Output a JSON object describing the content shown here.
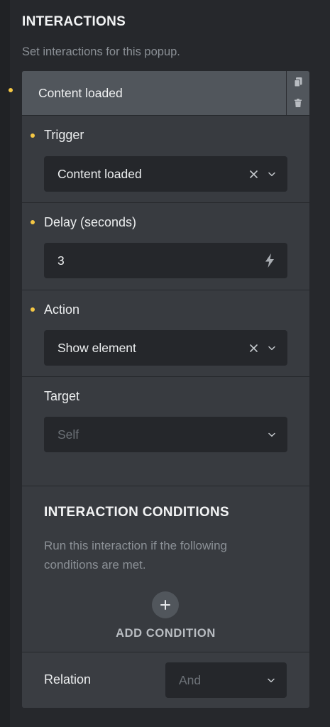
{
  "section": {
    "title": "INTERACTIONS",
    "description": "Set interactions for this popup."
  },
  "interaction": {
    "header_title": "Content loaded",
    "duplicate_icon": "copy-icon",
    "delete_icon": "trash-icon"
  },
  "fields": {
    "trigger": {
      "label": "Trigger",
      "value": "Content loaded"
    },
    "delay": {
      "label": "Delay (seconds)",
      "value": "3",
      "dynamic_icon": "bolt-icon"
    },
    "action": {
      "label": "Action",
      "value": "Show element"
    },
    "target": {
      "label": "Target",
      "placeholder": "Self"
    }
  },
  "conditions": {
    "title": "INTERACTION CONDITIONS",
    "description": "Run this interaction if the following conditions are met.",
    "add_label": "ADD CONDITION",
    "relation_label": "Relation",
    "relation_placeholder": "And"
  },
  "colors": {
    "modified_dot": "#f5c744",
    "panel_bg": "#26282c",
    "card_bg": "#383b40",
    "header_bg": "#51565c",
    "control_bg": "#25272b"
  }
}
